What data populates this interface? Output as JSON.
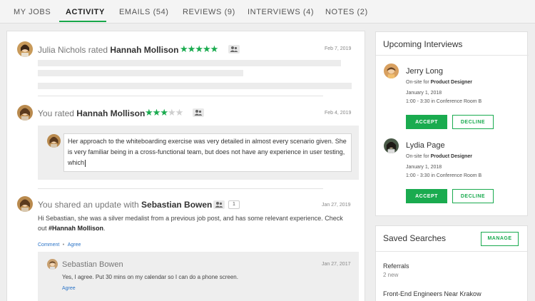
{
  "nav": {
    "tabs": [
      {
        "label": "MY JOBS"
      },
      {
        "label": "ACTIVITY"
      },
      {
        "label": "EMAILS (54)"
      },
      {
        "label": "REVIEWS (9)"
      },
      {
        "label": "INTERVIEWS (4)"
      },
      {
        "label": "NOTES (2)"
      }
    ],
    "active_tab": "ACTIVITY"
  },
  "feed": {
    "item1": {
      "actor": "Julia Nichols",
      "verb": "rated",
      "subject": "Hannah Mollison",
      "stars": 5,
      "date": "Feb 7, 2019"
    },
    "item2": {
      "actor": "You",
      "verb": "rated",
      "subject": "Hannah Mollison",
      "stars": 3,
      "date": "Feb 4, 2019",
      "review_text": "Her approach to the whiteboarding exercise was very detailed in almost every scenario given. She is very familiar being in a cross-functional team, but does not have any experience in user testing, which"
    },
    "item3": {
      "prefix": "You shared an update with",
      "subject": "Sebastian Bowen",
      "share_count": "1",
      "date": "Jan 27, 2019",
      "body": "Hi Sebastian, she was a silver medalist from a previous job post, and has some relevant experience. Check out",
      "mention": "#Hannah Mollison",
      "mention_suffix": ".",
      "actions": {
        "comment": "Comment",
        "separator": "•",
        "agree": "Agree"
      },
      "reply": {
        "author": "Sebastian Bowen",
        "date": "Jan 27, 2017",
        "text": "Yes, I agree. Put 30 mins on my calendar so I can do a phone screen.",
        "agree": "Agree"
      }
    }
  },
  "upcoming": {
    "title": "Upcoming Interviews",
    "interviews": [
      {
        "name": "Jerry Long",
        "type_prefix": "On-site for",
        "role": "Product Designer",
        "date": "January 1, 2018",
        "time": "1:00 - 3:30 in Conference Room B",
        "accept": "ACCEPT",
        "decline": "DECLINE"
      },
      {
        "name": "Lydia Page",
        "type_prefix": "On-site for",
        "role": "Product Designer",
        "date": "January 1, 2018",
        "time": "1:00 - 3:30 in Conference Room B",
        "accept": "ACCEPT",
        "decline": "DECLINE"
      }
    ]
  },
  "saved_searches": {
    "title": "Saved Searches",
    "manage": "MANAGE",
    "items": [
      {
        "name": "Referrals",
        "count": "2 new"
      },
      {
        "name": "Front-End Engineers Near Krakow"
      }
    ]
  },
  "colors": {
    "accent": "#1aab4f",
    "link": "#2a73c7",
    "star_off": "#cfcfcf"
  },
  "icons": [
    "star-icon",
    "share-people-icon",
    "avatar"
  ]
}
